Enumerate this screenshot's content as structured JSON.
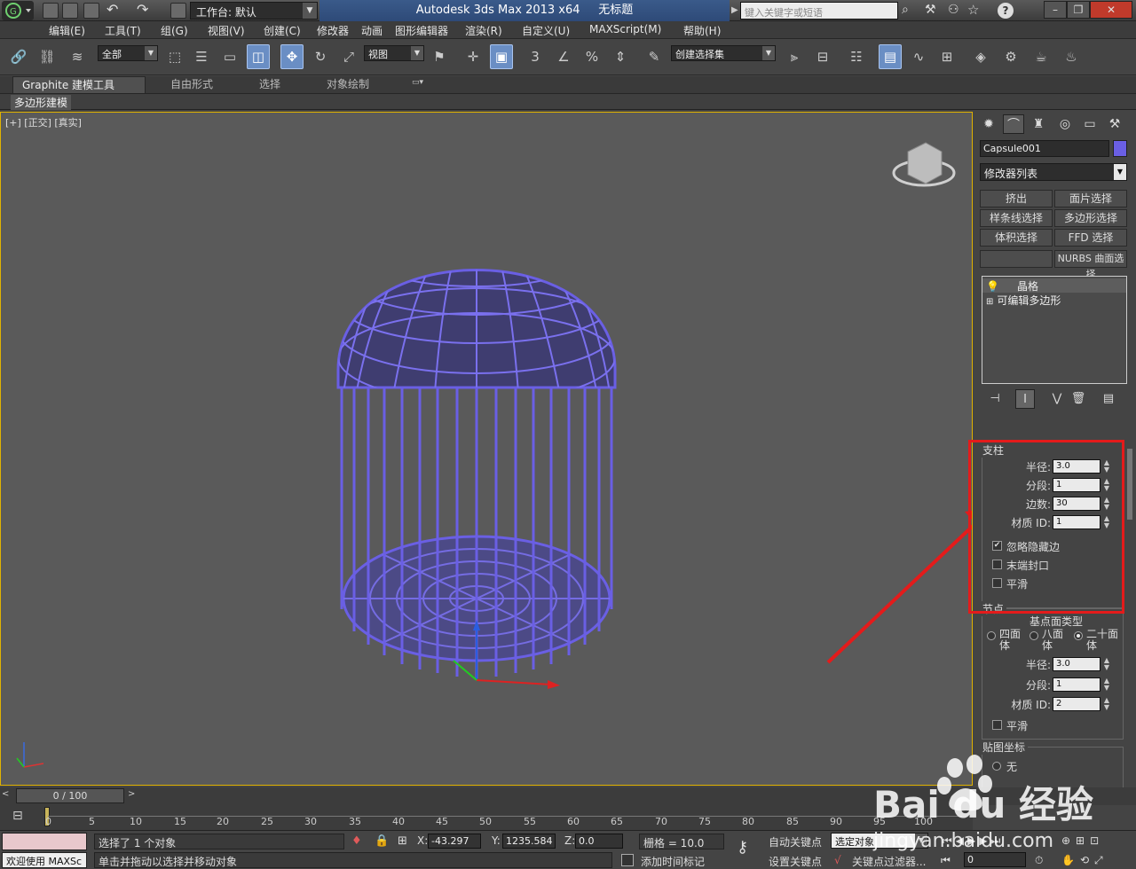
{
  "window": {
    "title": "Autodesk 3ds Max  2013 x64",
    "doc": "无标题",
    "workspace": "工作台: 默认",
    "search_placeholder": "键入关键字或短语"
  },
  "menu": [
    "编辑(E)",
    "工具(T)",
    "组(G)",
    "视图(V)",
    "创建(C)",
    "修改器",
    "动画",
    "图形编辑器",
    "渲染(R)",
    "自定义(U)",
    "MAXScript(M)",
    "帮助(H)"
  ],
  "toolbar": {
    "filter": "全部",
    "refcoord": "视图",
    "selset": "创建选择集",
    "snap": "3",
    "percent": "%"
  },
  "ribbon": {
    "tabs": [
      "Graphite 建模工具",
      "自由形式",
      "选择",
      "对象绘制"
    ],
    "subtab": "多边形建模"
  },
  "viewport": {
    "label": "[+] [正交] [真实]",
    "cage_color": "#6a5fe4"
  },
  "panel": {
    "object_name": "Capsule001",
    "object_color": "#6a5fe4",
    "modifier_list": "修改器列表",
    "mod_buttons": [
      "挤出",
      "面片选择",
      "样条线选择",
      "多边形选择",
      "体积选择",
      "FFD 选择",
      "",
      "NURBS 曲面选择"
    ],
    "stack": [
      "晶格",
      "可编辑多边形"
    ],
    "struts": {
      "title": "支柱",
      "radius_label": "半径:",
      "radius": "3.0",
      "segments_label": "分段:",
      "segments": "1",
      "sides_label": "边数:",
      "sides": "30",
      "matid_label": "材质 ID:",
      "matid": "1",
      "ignore_hidden": "忽略隐藏边",
      "ignore_hidden_checked": true,
      "end_caps": "末端封口",
      "end_caps_checked": false,
      "smooth": "平滑",
      "smooth_checked": false
    },
    "joints": {
      "title": "节点",
      "geo_type": "基点面类型",
      "opt_tetra": "四面体",
      "opt_octa": "八面体",
      "opt_icosa": "二十面体",
      "selected": "icosa",
      "radius_label": "半径:",
      "radius": "3.0",
      "segments_label": "分段:",
      "segments": "1",
      "matid_label": "材质 ID:",
      "matid": "2",
      "smooth": "平滑",
      "smooth_checked": false
    },
    "mapping": {
      "title": "贴图坐标",
      "none": "无"
    }
  },
  "timeline": {
    "slider": "0 / 100",
    "ticks": [
      "0",
      "5",
      "10",
      "15",
      "20",
      "25",
      "30",
      "35",
      "40",
      "45",
      "50",
      "55",
      "60",
      "65",
      "70",
      "75",
      "80",
      "85",
      "90",
      "95",
      "100"
    ]
  },
  "status": {
    "welcome": "欢迎使用 MAXSc",
    "selected": "选择了 1 个对象",
    "prompt": "单击并拖动以选择并移动对象",
    "x_label": "X:",
    "x": "-43.297",
    "y_label": "Y:",
    "y": "1235.584",
    "z_label": "Z:",
    "z": "0.0",
    "grid": "栅格 = 10.0",
    "auto_key": "自动关键点",
    "set_key": "设置关键点",
    "key_mode": "选定对象",
    "key_filter": "关键点过滤器...",
    "add_time_tag": "添加时间标记",
    "frame": "0"
  },
  "watermark": {
    "brand": "Bai du 经验",
    "url": "jingyan.baidu.com"
  }
}
